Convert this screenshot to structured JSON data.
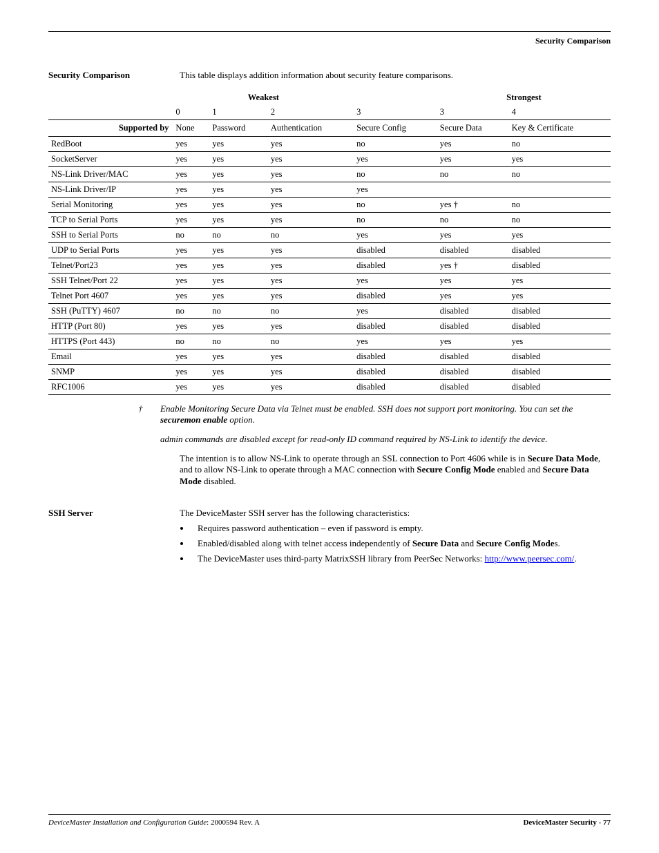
{
  "header": {
    "title": "Security Comparison"
  },
  "section1": {
    "label": "Security Comparison",
    "intro": "This table displays addition information about security feature comparisons."
  },
  "table": {
    "strength": {
      "weakest": "Weakest",
      "strongest": "Strongest"
    },
    "nums": [
      "0",
      "1",
      "2",
      "3",
      "3",
      "4"
    ],
    "supported_by": "Supported by",
    "cols": [
      "None",
      "Password",
      "Authentication",
      "Secure Config",
      "Secure Data",
      "Key & Certificate"
    ],
    "rows": [
      {
        "name": "RedBoot",
        "v": [
          "yes",
          "yes",
          "yes",
          "no",
          "yes",
          "no"
        ]
      },
      {
        "name": "SocketServer",
        "v": [
          "yes",
          "yes",
          "yes",
          "yes",
          "yes",
          "yes"
        ]
      },
      {
        "name": "NS-Link Driver/MAC",
        "v": [
          "yes",
          "yes",
          "yes",
          "no",
          "no",
          "no"
        ]
      },
      {
        "name": "NS-Link Driver/IP",
        "v": [
          "yes",
          "yes",
          "yes",
          "yes",
          "",
          ""
        ]
      },
      {
        "name": "Serial Monitoring",
        "v": [
          "yes",
          "yes",
          "yes",
          "no",
          "yes †",
          "no"
        ]
      },
      {
        "name": "TCP to Serial Ports",
        "v": [
          "yes",
          "yes",
          "yes",
          "no",
          "no",
          "no"
        ]
      },
      {
        "name": "SSH to Serial Ports",
        "v": [
          "no",
          "no",
          "no",
          "yes",
          "yes",
          "yes"
        ]
      },
      {
        "name": "UDP to Serial Ports",
        "v": [
          "yes",
          "yes",
          "yes",
          "disabled",
          "disabled",
          "disabled"
        ]
      },
      {
        "name": "Telnet/Port23",
        "v": [
          "yes",
          "yes",
          "yes",
          "disabled",
          "yes †",
          "disabled"
        ]
      },
      {
        "name": "SSH Telnet/Port 22",
        "v": [
          "yes",
          "yes",
          "yes",
          "yes",
          "yes",
          "yes"
        ]
      },
      {
        "name": "Telnet Port 4607",
        "v": [
          "yes",
          "yes",
          "yes",
          "disabled",
          "yes",
          "yes"
        ]
      },
      {
        "name": "SSH (PuTTY) 4607",
        "v": [
          "no",
          "no",
          "no",
          "yes",
          "disabled",
          "disabled"
        ]
      },
      {
        "name": "HTTP (Port 80)",
        "v": [
          "yes",
          "yes",
          "yes",
          "disabled",
          "disabled",
          "disabled"
        ]
      },
      {
        "name": "HTTPS (Port 443)",
        "v": [
          "no",
          "no",
          "no",
          "yes",
          "yes",
          "yes"
        ]
      },
      {
        "name": "Email",
        "v": [
          "yes",
          "yes",
          "yes",
          "disabled",
          "disabled",
          "disabled"
        ]
      },
      {
        "name": "SNMP",
        "v": [
          "yes",
          "yes",
          "yes",
          "disabled",
          "disabled",
          "disabled"
        ]
      },
      {
        "name": "RFC1006",
        "v": [
          "yes",
          "yes",
          "yes",
          "disabled",
          "disabled",
          "disabled"
        ]
      }
    ]
  },
  "notes": {
    "symbol": "†",
    "note1_a": "Enable Monitoring Secure Data via Telnet must be enabled. SSH does not support port monitoring. You can set the ",
    "note1_bold": "securemon enable",
    "note1_b": " option.",
    "note2": "admin commands are disabled except for read-only ID command required by NS-Link to identify the device."
  },
  "para1": {
    "a": "The intention is to allow NS-Link to operate through an SSL connection to Port 4606 while is in ",
    "b1": "Secure Data Mode",
    "c": ", and to allow NS-Link to operate through a MAC connection with ",
    "b2": "Secure Config Mode",
    "d": " enabled and ",
    "b3": "Secure Data Mode",
    "e": " disabled."
  },
  "section2": {
    "label": "SSH Server",
    "intro": "The DeviceMaster SSH server has the following characteristics:",
    "b1": "Requires password authentication – even if password is empty.",
    "b2_a": "Enabled/disabled along with telnet access independently of ",
    "b2_b1": "Secure Data",
    "b2_b": " and ",
    "b2_b2": "Secure Config Mode",
    "b2_c": "s.",
    "b3_a": "The DeviceMaster uses third-party MatrixSSH library from PeerSec Networks: ",
    "b3_link": "http://www.peersec.com/",
    "b3_b": "."
  },
  "footer": {
    "left_a": "DeviceMaster Installation and Configuration Guide",
    "left_b": ": 2000594 Rev. A",
    "right": "DeviceMaster Security  - 77"
  }
}
